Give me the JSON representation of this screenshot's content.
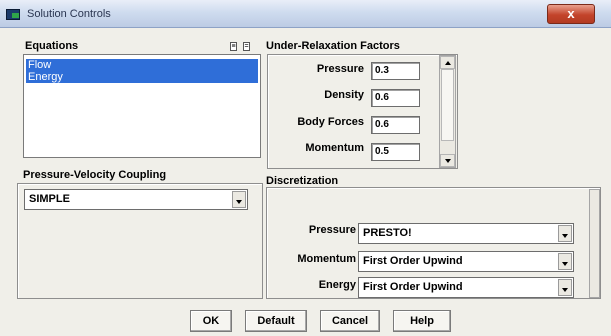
{
  "window": {
    "title": "Solution Controls",
    "close_label": "x"
  },
  "equations": {
    "label": "Equations",
    "select_all_label": "≡",
    "deselect_all_label": "=",
    "items": [
      "Flow",
      "Energy"
    ]
  },
  "under_relaxation": {
    "label": "Under-Relaxation Factors",
    "fields": [
      {
        "label": "Pressure",
        "value": "0.3"
      },
      {
        "label": "Density",
        "value": "0.6"
      },
      {
        "label": "Body Forces",
        "value": "0.6"
      },
      {
        "label": "Momentum",
        "value": "0.5"
      }
    ]
  },
  "pressure_velocity": {
    "label": "Pressure-Velocity Coupling",
    "value": "SIMPLE"
  },
  "discretization": {
    "label": "Discretization",
    "rows": [
      {
        "label": "Pressure",
        "value": "PRESTO!"
      },
      {
        "label": "Momentum",
        "value": "First Order Upwind"
      },
      {
        "label": "Energy",
        "value": "First Order Upwind"
      }
    ]
  },
  "buttons": {
    "ok": "OK",
    "default": "Default",
    "cancel": "Cancel",
    "help": "Help"
  }
}
